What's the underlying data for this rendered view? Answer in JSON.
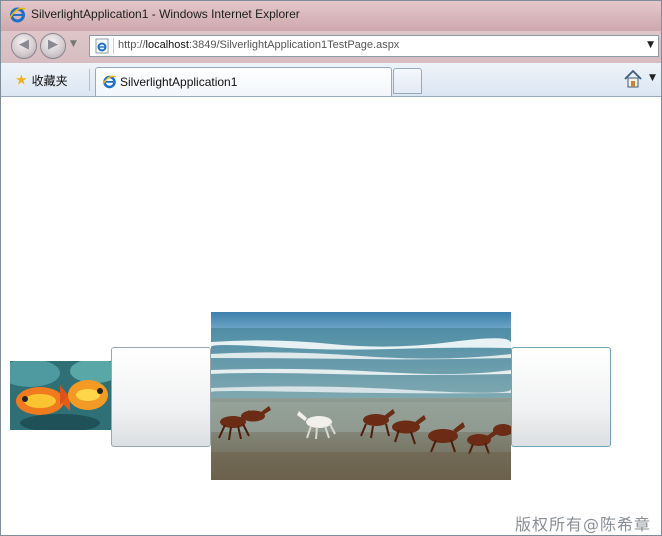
{
  "window": {
    "title": "SilverlightApplication1 - Windows Internet Explorer"
  },
  "navigation": {
    "back_icon": "back-arrow-icon",
    "forward_icon": "forward-arrow-icon",
    "address": {
      "prefix": "http://",
      "host": "localhost",
      "rest": ":3849/SilverlightApplication1TestPage.aspx"
    }
  },
  "tabs": {
    "favorites_label": "收藏夹",
    "active_tab_label": "SilverlightApplication1"
  },
  "carousel": {
    "items": [
      {
        "name": "fish-image",
        "kind": "image"
      },
      {
        "name": "empty-slot-left",
        "kind": "empty"
      },
      {
        "name": "horses-on-beach-image",
        "kind": "image",
        "selected": true
      },
      {
        "name": "empty-slot-right",
        "kind": "empty"
      }
    ]
  },
  "watermark": "版权所有@陈希章",
  "colors": {
    "title_bar": "#d9b9bd",
    "tab_bar": "#dbe6f3",
    "sea": "#6e98a6",
    "sky": "#4e8ab0",
    "sand": "#7e8b84"
  }
}
